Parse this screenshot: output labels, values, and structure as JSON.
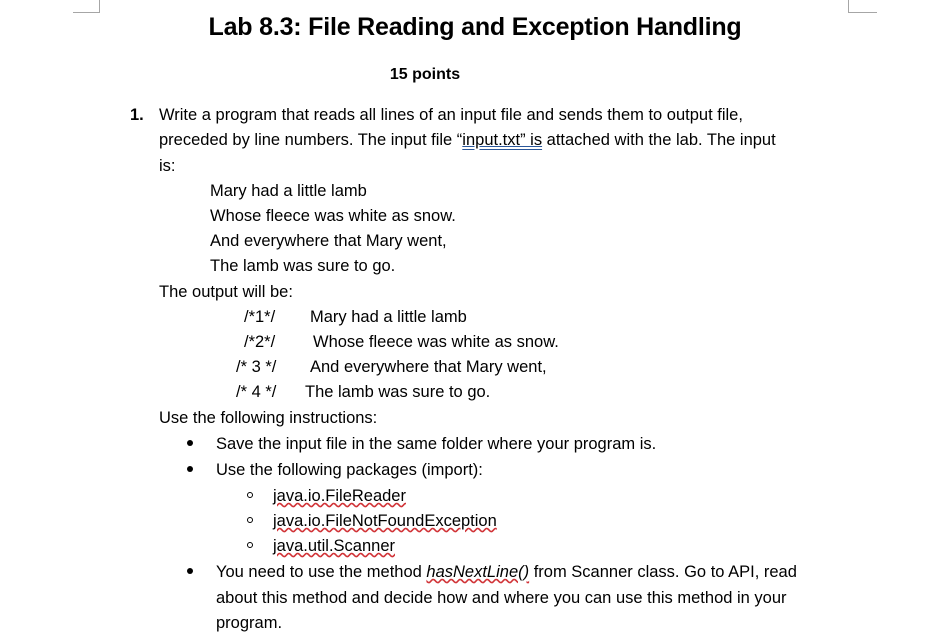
{
  "title": "Lab 8.3:  File Reading and Exception Handling",
  "points": "15 points",
  "q1": {
    "number": "1.",
    "line1": "Write a program that reads all lines of an input file and sends them to output file,",
    "line2_a": "preceded by line numbers.  The input file “",
    "line2_file": "input.txt”  is",
    "line2_b": " attached with the lab. The input",
    "line3": "is:"
  },
  "input_lines": [
    "Mary had a little lamb",
    "Whose fleece was white as snow.",
    "And everywhere that Mary went,",
    "The lamb was sure to go."
  ],
  "output_label": "The output will be:",
  "output_lines": [
    {
      "num": "/*1*/",
      "text": "Mary had a little lamb"
    },
    {
      "num": "/*2*/",
      "text": "Whose fleece was white as snow."
    },
    {
      "num": "/* 3 */",
      "text": "And everywhere that Mary went,"
    },
    {
      "num": "/* 4 */",
      "text": "The lamb was sure to go."
    }
  ],
  "instructions_label": "Use the following instructions:",
  "bullets": {
    "b1": "Save the input file in the same folder where your program is.",
    "b2": "Use the following packages (import):",
    "packages": [
      "java.io.FileReader",
      "java.io.FileNotFoundException",
      "java.util.Scanner"
    ],
    "b3_a": "You need to use the method ",
    "b3_method": "hasNextLine()",
    "b3_b": " from Scanner class. Go to API, read",
    "b3_line2": "about this method and decide how and where you can use this method in your",
    "b3_line3": "program."
  }
}
